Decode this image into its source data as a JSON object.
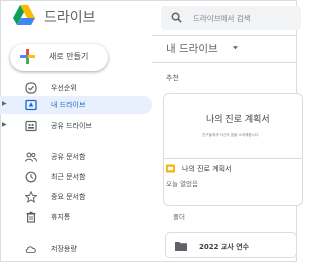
{
  "app": {
    "brand": "드라이브"
  },
  "search": {
    "placeholder": "드라이브에서 검색"
  },
  "new_button": {
    "label": "새로 만들기"
  },
  "sidebar": {
    "items": [
      {
        "label": "우선순위",
        "icon": "checkbox-circle-icon"
      },
      {
        "label": "내 드라이브",
        "icon": "drive-icon",
        "active": true,
        "has_arrow": true
      },
      {
        "label": "공유 드라이브",
        "icon": "shared-drive-icon",
        "has_arrow": true
      },
      {
        "label": "공유 문서함",
        "icon": "people-icon"
      },
      {
        "label": "최근 문서함",
        "icon": "clock-icon"
      },
      {
        "label": "중요 문서함",
        "icon": "star-icon"
      },
      {
        "label": "휴지통",
        "icon": "trash-icon"
      },
      {
        "label": "저장용량",
        "icon": "cloud-icon"
      }
    ]
  },
  "main": {
    "breadcrumb": "내 드라이브",
    "recommended_label": "추천",
    "card": {
      "preview_title": "나의 진로 계획서",
      "preview_subtitle": "친구들에게 자신의 꿈을 소개해봅시다.",
      "name": "나의 진로 계획서",
      "meta": "오늘 열었음",
      "icon_color": "#f4b400"
    },
    "folders_label": "폴더",
    "folders": [
      {
        "name": "2022 교사 연수"
      }
    ]
  },
  "colors": {
    "accent": "#1967d2",
    "active_bg": "#e8f0fe"
  }
}
